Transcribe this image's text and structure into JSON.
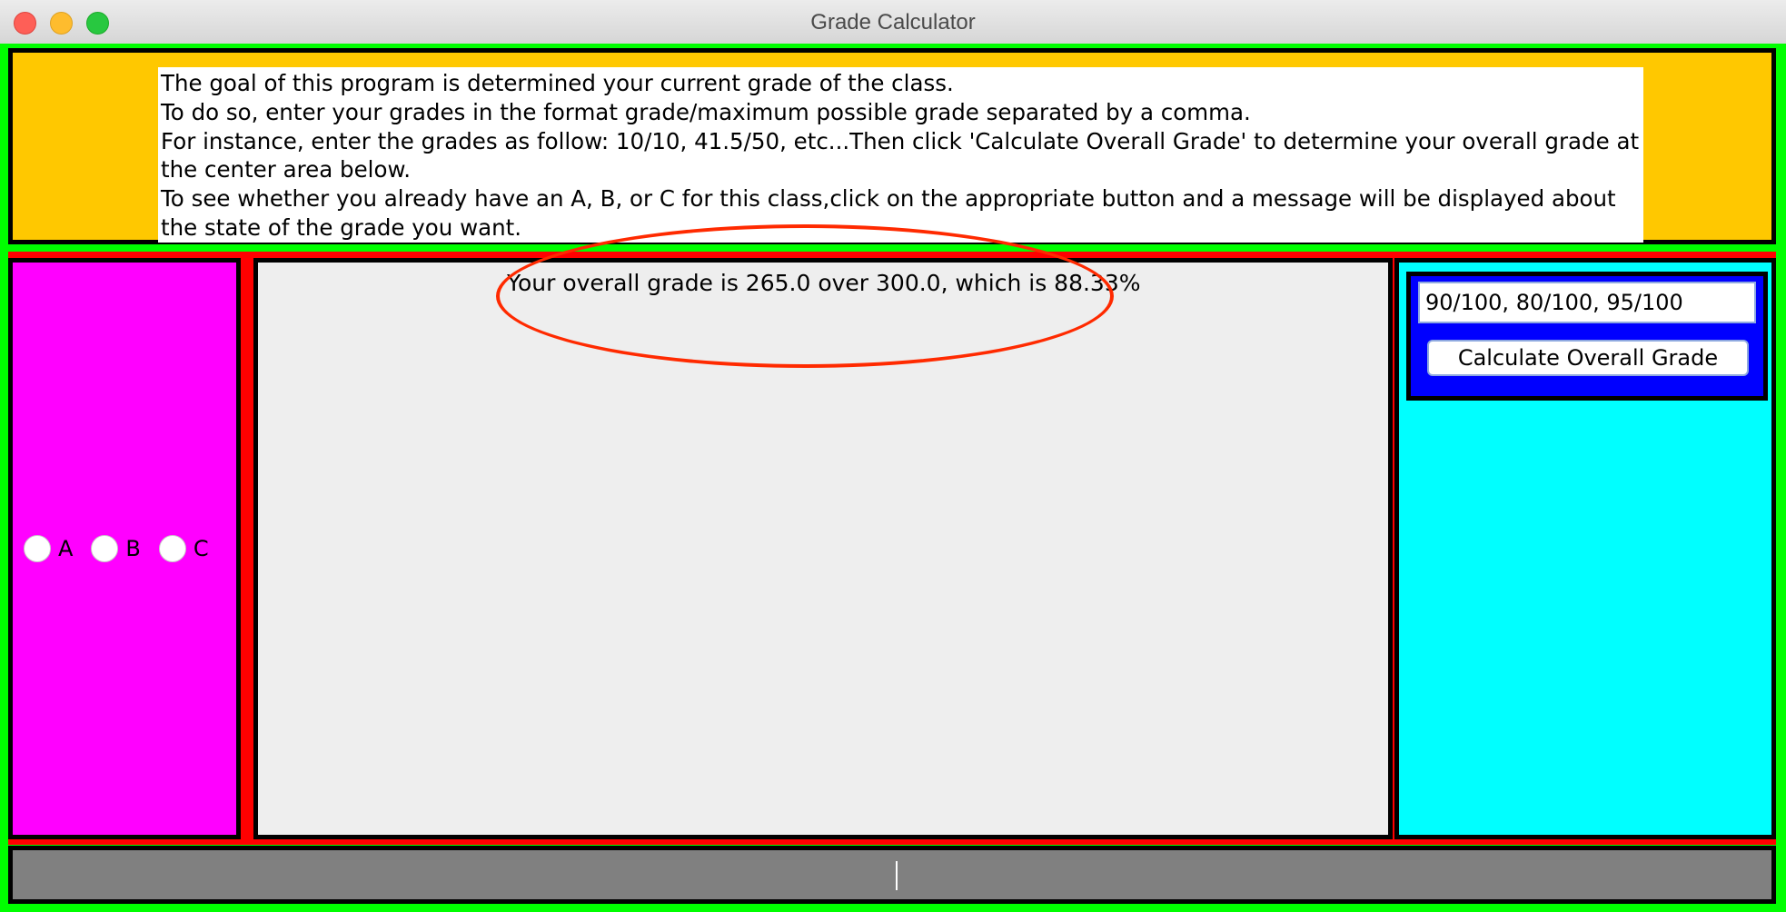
{
  "window": {
    "title": "Grade Calculator"
  },
  "instructions": {
    "lines": [
      "The goal of this program is determined your current grade of the class.",
      "To do so, enter your grades in the format grade/maximum possible grade separated by a comma.",
      "For instance, enter the grades as follow: 10/10, 41.5/50, etc...Then click 'Calculate Overall Grade' to determine your overall grade at the center area below.",
      "To see whether you already have an A, B, or C for this class,click on the appropriate button and a message will be displayed about the state of the grade you want."
    ]
  },
  "grade_options": [
    {
      "label": "A",
      "selected": false
    },
    {
      "label": "B",
      "selected": false
    },
    {
      "label": "C",
      "selected": false
    }
  ],
  "result": {
    "text": "Your overall grade is 265.0 over 300.0, which is 88.33%"
  },
  "controls": {
    "grades_input_value": "90/100, 80/100, 95/100",
    "calculate_button_label": "Calculate Overall Grade"
  },
  "colors": {
    "frame": "#00ff00",
    "north_panel": "#ffc800",
    "west_panel": "#ff00ff",
    "center_panel": "#eeeeee",
    "east_panel": "#00ffff",
    "control_box": "#0000ff",
    "center_band": "#ff0000",
    "south_panel": "#808080",
    "highlight": "#ff2a00"
  }
}
